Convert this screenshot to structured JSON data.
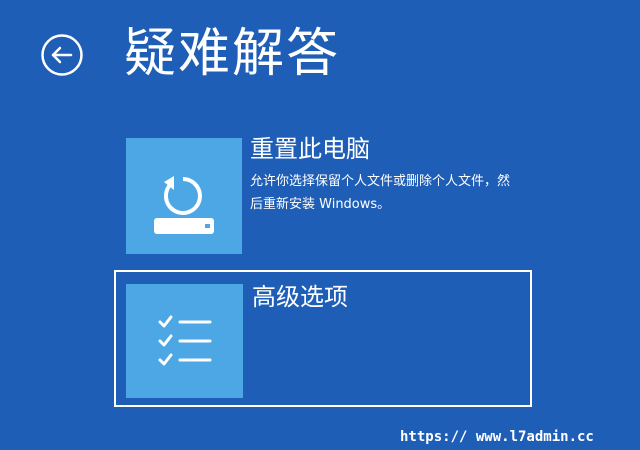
{
  "theme": {
    "background": "#1f5eb6",
    "tile_color": "#4da7e4",
    "text_color": "#ffffff"
  },
  "header": {
    "back_icon": "back-arrow-icon",
    "title": "疑难解答"
  },
  "options": [
    {
      "icon": "reset-pc-icon",
      "title": "重置此电脑",
      "description": "允许你选择保留个人文件或删除个人文件，然后重新安装 Windows。"
    },
    {
      "icon": "checklist-icon",
      "title": "高级选项",
      "selected": true
    }
  ],
  "watermark": "https:// www.l7admin.cc"
}
